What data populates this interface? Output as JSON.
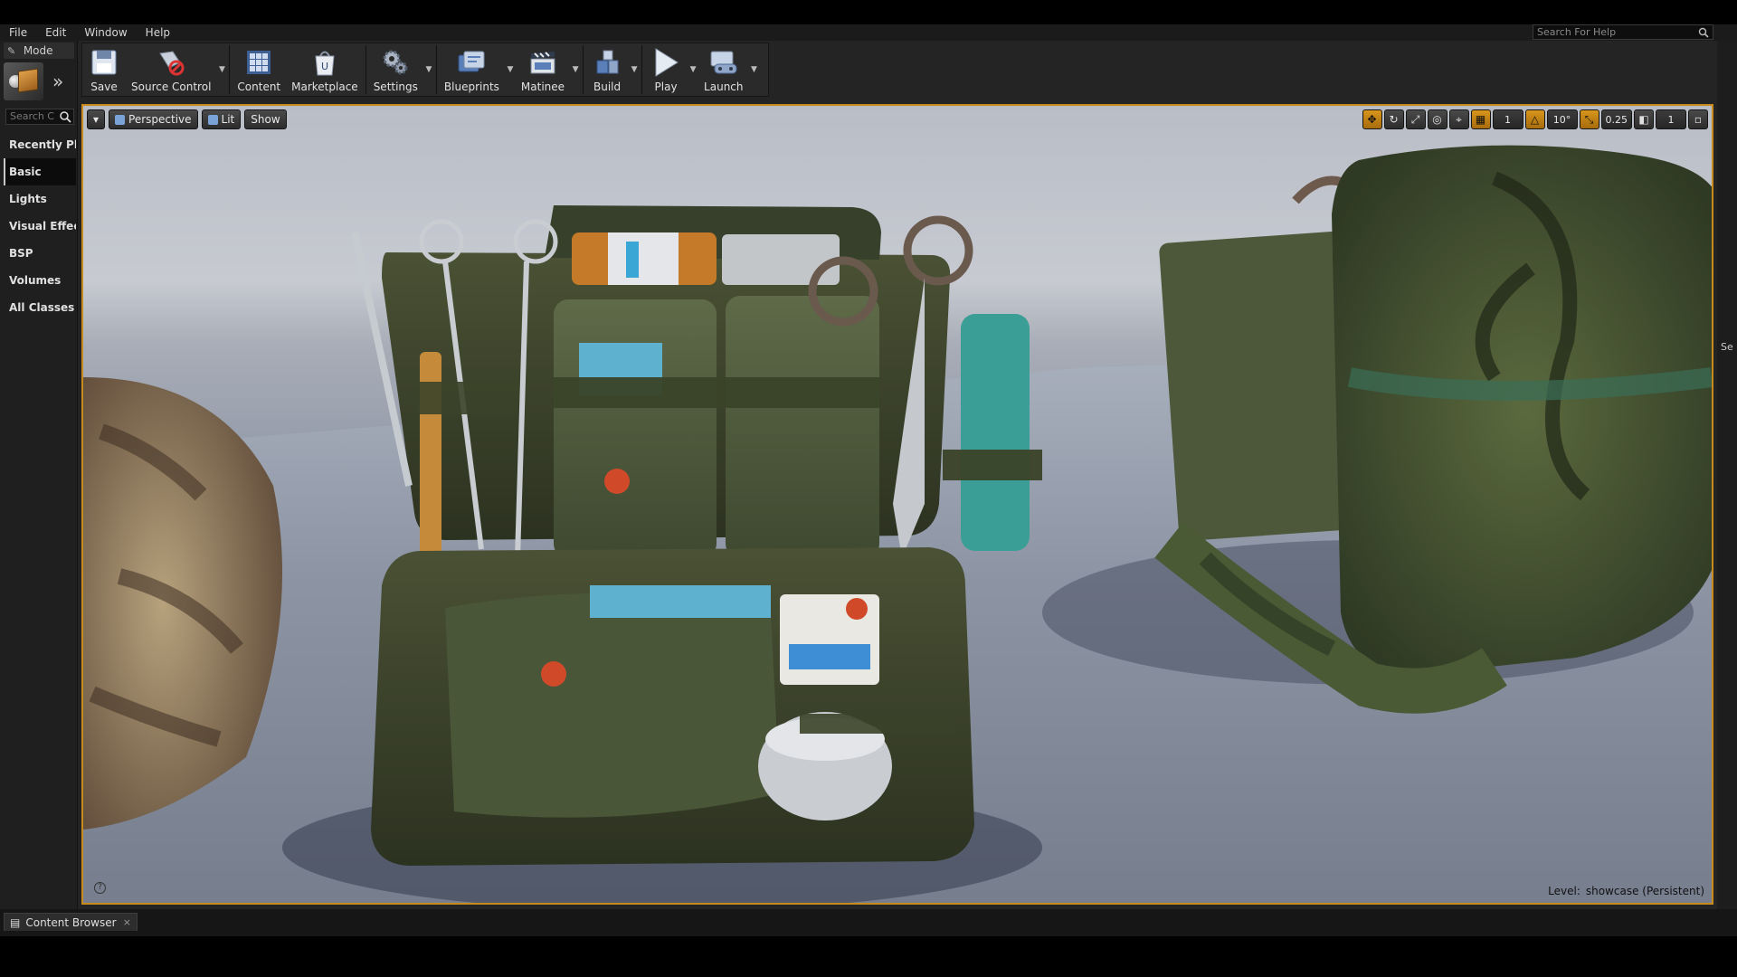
{
  "menu": [
    "File",
    "Edit",
    "Window",
    "Help"
  ],
  "help_search": {
    "placeholder": "Search For Help"
  },
  "modes": {
    "tab_label": "Mode",
    "search_placeholder": "Search C",
    "categories": [
      "Recently Pla",
      "Basic",
      "Lights",
      "Visual Effect",
      "BSP",
      "Volumes",
      "All Classes"
    ],
    "active_category": "Basic"
  },
  "toolbar": {
    "save": "Save",
    "source_control": "Source Control",
    "content": "Content",
    "marketplace": "Marketplace",
    "settings": "Settings",
    "blueprints": "Blueprints",
    "matinee": "Matinee",
    "build": "Build",
    "play": "Play",
    "launch": "Launch"
  },
  "viewport": {
    "view_mode": "Perspective",
    "lighting": "Lit",
    "show": "Show",
    "rotation_snap": "10°",
    "scale_snap": "0.25",
    "camera_speed": "1",
    "grid_count": "1",
    "level_label": "Level:",
    "level_name": "showcase (Persistent)",
    "accent_color": "#c88a1b"
  },
  "right_panel": {
    "label": "Se"
  },
  "bottom": {
    "tab_label": "Content Browser"
  }
}
